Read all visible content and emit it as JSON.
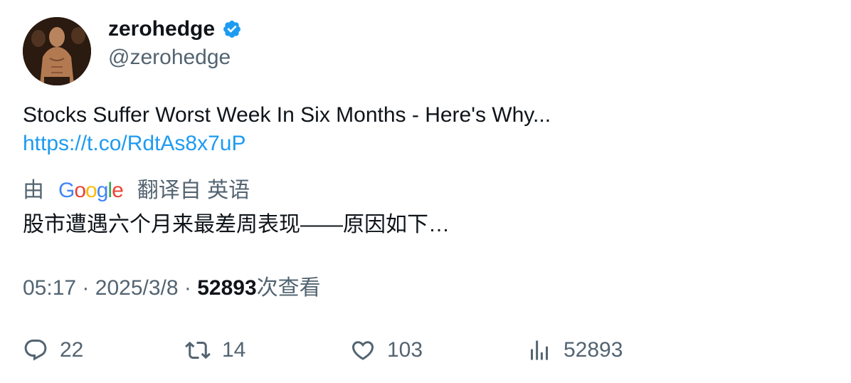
{
  "author": {
    "name": "zerohedge",
    "handle": "@zerohedge",
    "verified_color": "#1d9bf0"
  },
  "tweet": {
    "text": "Stocks Suffer Worst Week In Six Months - Here's Why...",
    "link": "https://t.co/RdtAs8x7uP"
  },
  "translation": {
    "prefix": "由",
    "provider_letters": [
      "G",
      "o",
      "o",
      "g",
      "l",
      "e"
    ],
    "suffix": "翻译自 英语",
    "text": "股市遭遇六个月来最差周表现——原因如下…"
  },
  "meta": {
    "time": "05:17",
    "sep1": "·",
    "date": "2025/3/8",
    "sep2": "·",
    "views": "52893",
    "views_label": "次查看"
  },
  "actions": {
    "replies": "22",
    "retweets": "14",
    "likes": "103",
    "views": "52893"
  },
  "icons": [
    "reply-icon",
    "retweet-icon",
    "like-icon",
    "views-icon",
    "verified-badge-icon"
  ]
}
